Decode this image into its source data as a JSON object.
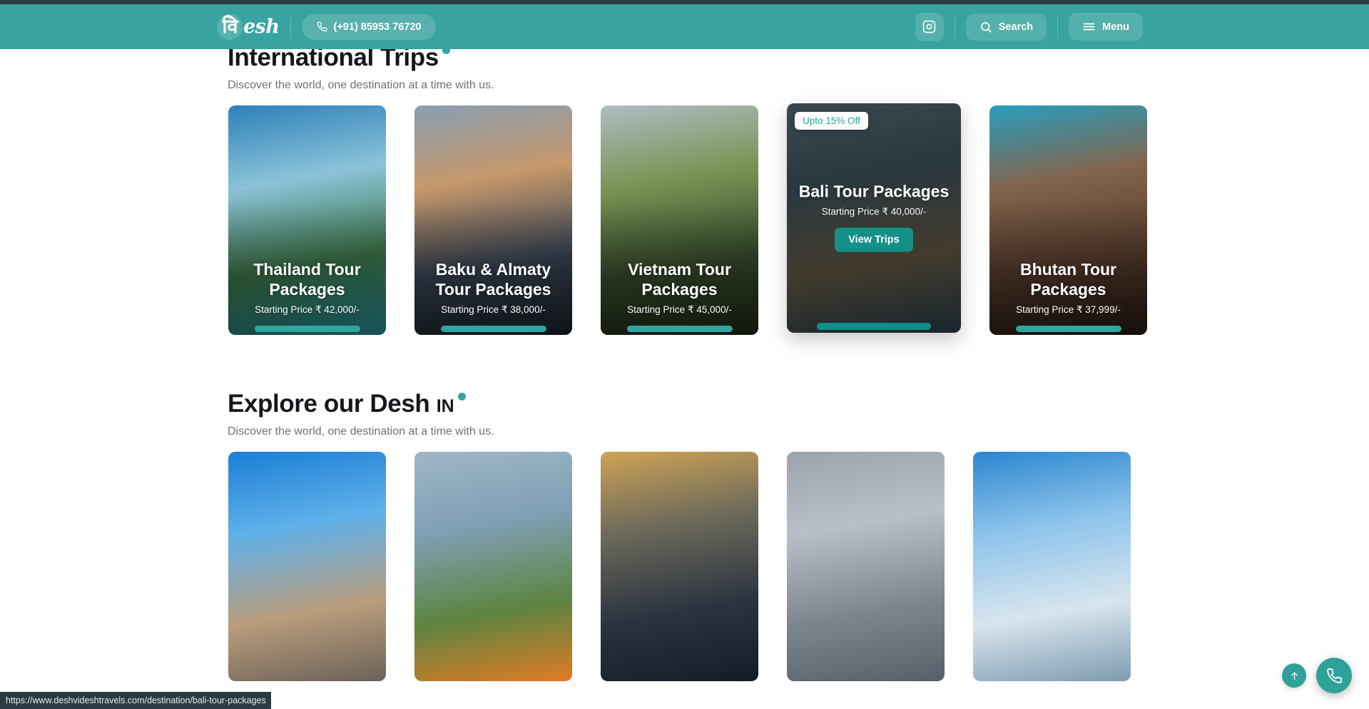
{
  "header": {
    "logo": {
      "deva": "वि",
      "word": "esh",
      "alt": "videsh-logo"
    },
    "phone": "(+91) 85953 76720",
    "instagram_label": "instagram",
    "search_label": "Search",
    "menu_label": "Menu",
    "bg_color": "#38a3a0"
  },
  "sections": [
    {
      "title": "International Trips",
      "title_suffix": "",
      "subtitle": "Discover the world, one destination at a time with us.",
      "cards": [
        {
          "title": "Thailand Tour Packages",
          "price": "Starting Price ₹ 42,000/-",
          "badge": null,
          "cta": null,
          "featured": false,
          "image_name": "thailand-limestone-bay",
          "colors": [
            "#2f87c4",
            "#93cfe6",
            "#3f7b4a",
            "#2fa8b6"
          ]
        },
        {
          "title": "Baku & Almaty Tour Packages",
          "price": "Starting Price ₹ 38,000/-",
          "badge": null,
          "cta": null,
          "featured": false,
          "image_name": "baku-flame-towers-skyline",
          "colors": [
            "#8fa6bb",
            "#d2a070",
            "#3c4a5c",
            "#1e2730"
          ]
        },
        {
          "title": "Vietnam Tour Packages",
          "price": "Starting Price ₹ 45,000/-",
          "badge": null,
          "cta": null,
          "featured": false,
          "image_name": "vietnam-mountain-temple",
          "colors": [
            "#b9c6cf",
            "#7f9e5a",
            "#3c5230",
            "#243018"
          ]
        },
        {
          "title": "Bali Tour Packages",
          "price": "Starting Price ₹ 40,000/-",
          "badge": "Upto 15% Off",
          "cta": "View Trips",
          "featured": true,
          "image_name": "bali-lake-temple",
          "colors": [
            "#5d6b72",
            "#3e4f56",
            "#6b5638",
            "#24333a"
          ]
        },
        {
          "title": "Bhutan Tour Packages",
          "price": "Starting Price ₹ 37,999/-",
          "badge": null,
          "cta": null,
          "featured": false,
          "image_name": "bhutan-tigers-nest-monastery",
          "colors": [
            "#2aa6c8",
            "#8a6a52",
            "#5b3f2e",
            "#2b1d15"
          ]
        }
      ]
    },
    {
      "title": "Explore our Desh",
      "title_suffix": "IN",
      "subtitle": "Discover the world, one destination at a time with us.",
      "cards": [
        {
          "title": "",
          "price": "",
          "badge": null,
          "cta": null,
          "featured": false,
          "image_name": "ladakh-monastery-blue-sky",
          "colors": [
            "#1a7fd4",
            "#5fb0ea",
            "#b99d7c",
            "#6d6258"
          ]
        },
        {
          "title": "",
          "price": "",
          "badge": null,
          "cta": null,
          "featured": false,
          "image_name": "paragliding-over-valley",
          "colors": [
            "#9fb6c7",
            "#7e9fb4",
            "#5d8440",
            "#e07a24"
          ]
        },
        {
          "title": "",
          "price": "",
          "badge": null,
          "cta": null,
          "featured": false,
          "image_name": "hiker-sunrise-mountain",
          "colors": [
            "#cfa356",
            "#6d6a5a",
            "#2a3340",
            "#141b26"
          ]
        },
        {
          "title": "",
          "price": "",
          "badge": null,
          "cta": null,
          "featured": false,
          "image_name": "misty-himalayan-peaks",
          "colors": [
            "#9aa4ab",
            "#b7c0c6",
            "#7c868d",
            "#55606a"
          ]
        },
        {
          "title": "",
          "price": "",
          "badge": null,
          "cta": null,
          "featured": false,
          "image_name": "snow-peaks-blue-sky",
          "colors": [
            "#2b86cf",
            "#8cc3ec",
            "#d8e5ee",
            "#7f9bb0"
          ]
        }
      ]
    }
  ],
  "floating": {
    "scroll_top_label": "scroll to top",
    "call_label": "call us"
  },
  "status_bar": {
    "url": "https://www.deshvideshtravels.com/destination/bali-tour-packages"
  },
  "theme": {
    "teal": "#38a3a0",
    "teal_dark": "#159089",
    "accent_bar": "#2fa6a0",
    "heading": "#14181c",
    "muted": "#6c7276"
  }
}
